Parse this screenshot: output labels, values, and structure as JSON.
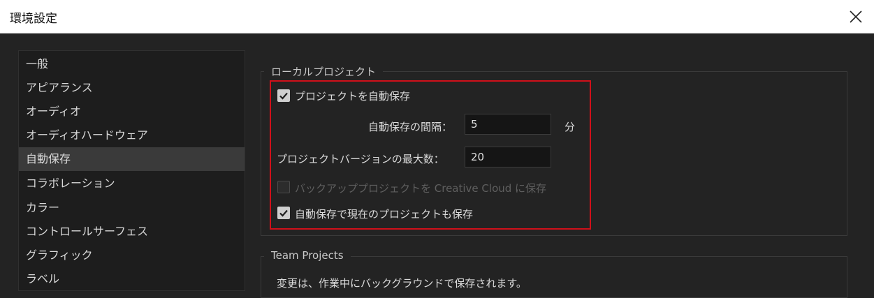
{
  "window": {
    "title": "環境設定"
  },
  "sidebar": {
    "items": [
      {
        "label": "一般"
      },
      {
        "label": "アピアランス"
      },
      {
        "label": "オーディオ"
      },
      {
        "label": "オーディオハードウェア"
      },
      {
        "label": "自動保存",
        "selected": true
      },
      {
        "label": "コラボレーション"
      },
      {
        "label": "カラー"
      },
      {
        "label": "コントロールサーフェス"
      },
      {
        "label": "グラフィック"
      },
      {
        "label": "ラベル"
      }
    ]
  },
  "local_project": {
    "title": "ローカルプロジェクト",
    "auto_save_label": "プロジェクトを自動保存",
    "auto_save_checked": true,
    "interval_label": "自動保存の間隔：",
    "interval_value": "5",
    "interval_unit": "分",
    "max_versions_label": "プロジェクトバージョンの最大数：",
    "max_versions_value": "20",
    "backup_label": "バックアッププロジェクトを Creative Cloud に保存",
    "backup_checked": false,
    "backup_enabled": false,
    "save_current_label": "自動保存で現在のプロジェクトも保存",
    "save_current_checked": true
  },
  "team_projects": {
    "title": "Team Projects",
    "description": "変更は、作業中にバックグラウンドで保存されます。"
  },
  "colors": {
    "highlight": "#d0101a",
    "accent_bg": "#232323"
  }
}
